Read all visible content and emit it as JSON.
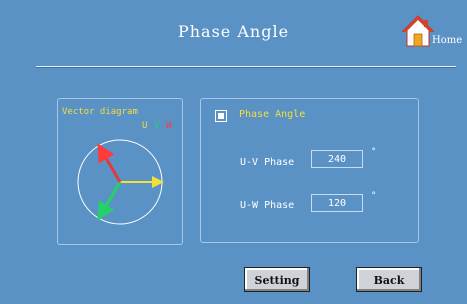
{
  "header": {
    "title": "Phase Angle",
    "home_label": "Home"
  },
  "vector_diagram": {
    "title": "Vector diagram",
    "legend": [
      "U",
      "V",
      "W"
    ],
    "colors": {
      "U": "#f3df3a",
      "V": "#24d06a",
      "W": "#ff3a3a"
    }
  },
  "phase_panel": {
    "checkbox_label": "Phase Angle",
    "rows": [
      {
        "label": "U-V Phase",
        "value": "240",
        "unit": "°"
      },
      {
        "label": "U-W Phase",
        "value": "120",
        "unit": "°"
      }
    ]
  },
  "buttons": {
    "setting": "Setting",
    "back": "Back"
  },
  "colors": {
    "background": "#5b92c6",
    "accent": "#f3df3a"
  }
}
